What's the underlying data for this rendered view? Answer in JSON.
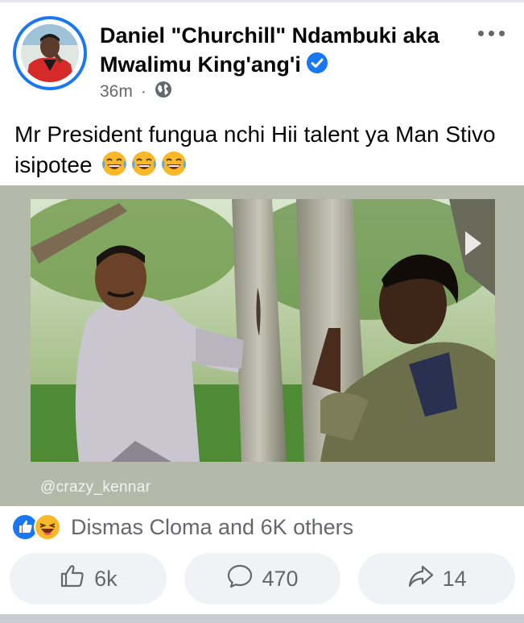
{
  "post": {
    "author": "Daniel \"Churchill\" Ndambuki aka Mwalimu King'ang'i",
    "timestamp": "36m",
    "visibility_icon": "globe-icon",
    "verified_icon": "verified-badge-icon",
    "caption": "Mr President fungua nchi Hii talent ya Man Stivo isipotee",
    "caption_emoji": [
      "face-with-tears-of-joy",
      "face-with-tears-of-joy",
      "face-with-tears-of-joy"
    ]
  },
  "media": {
    "watermark": "@crazy_kennar",
    "play_icon": "play-icon"
  },
  "reactions": {
    "icons": [
      "like-icon",
      "haha-icon"
    ],
    "summary": "Dismas Cloma and 6K others"
  },
  "actions": {
    "like_count": "6k",
    "comment_count": "470",
    "share_count": "14"
  },
  "colors": {
    "brand_blue": "#1877f2",
    "secondary_text": "#65676b",
    "button_bg": "#f0f2f5",
    "haha_yellow": "#f7b928"
  }
}
